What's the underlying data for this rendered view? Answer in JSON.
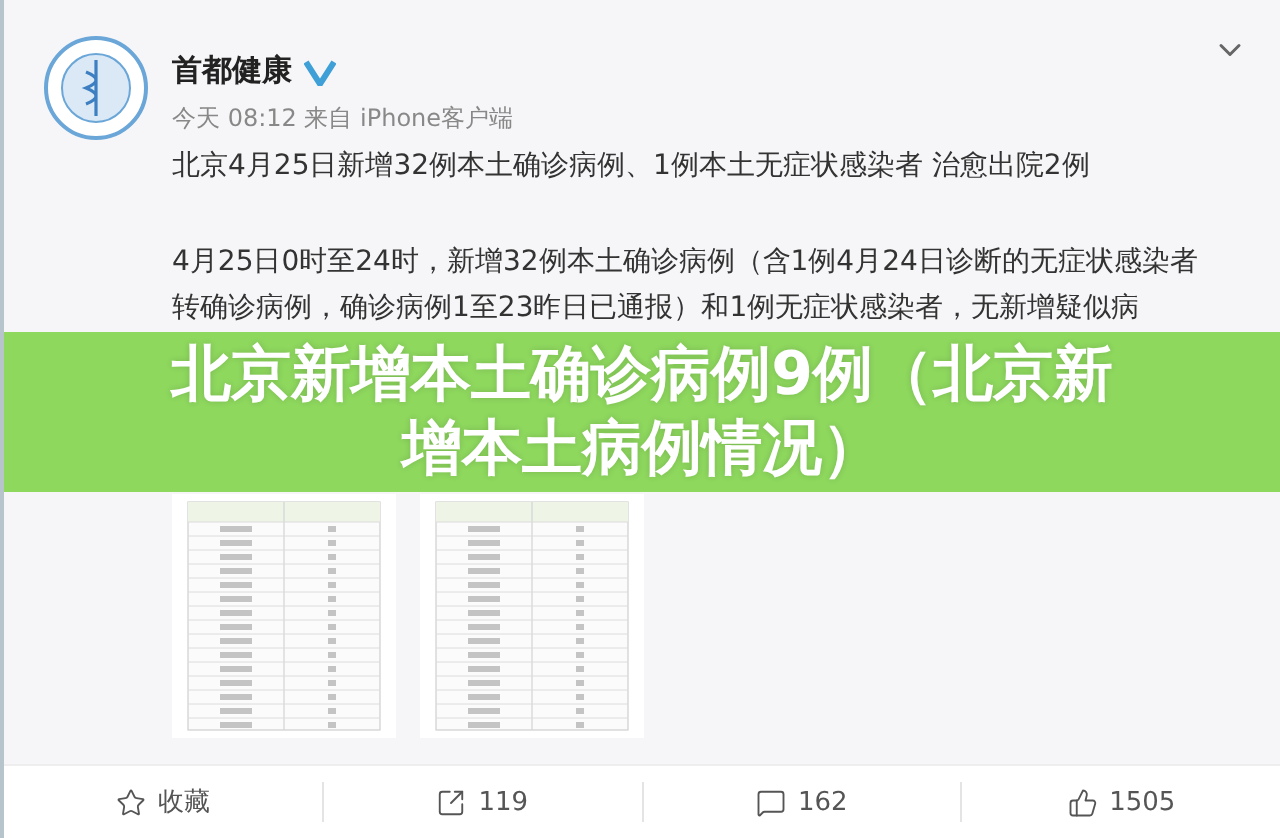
{
  "post": {
    "author": "首都健康",
    "verified": true,
    "meta": "今天 08:12 来自 iPhone客户端",
    "headline": "北京4月25日新增32例本土确诊病例、1例本土无症状感染者 治愈出院2例",
    "body_lines": [
      "4月25日0时至24时，新增32例本土确诊病例（含1例4月24日诊断的无症状感染者",
      "转确诊病例，确诊病例1至23昨日已通报）和1例无症状感染者，无新增疑似病"
    ]
  },
  "banner": {
    "title": "北京新增本土确诊病例9例（北京新增本土病例情况）"
  },
  "actions": [
    {
      "kind": "star",
      "label": "收藏"
    },
    {
      "kind": "share",
      "label": "119"
    },
    {
      "kind": "comment",
      "label": "162"
    },
    {
      "kind": "like",
      "label": "1505"
    }
  ]
}
